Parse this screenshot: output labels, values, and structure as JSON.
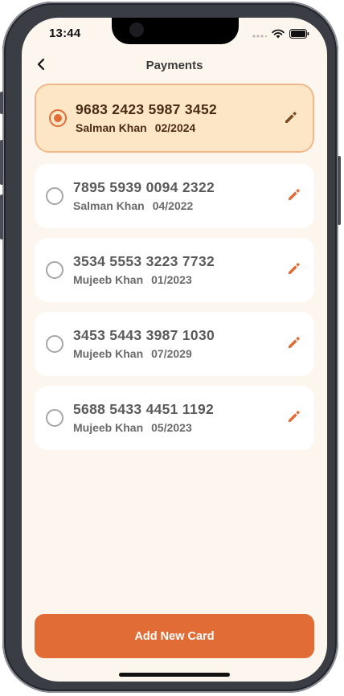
{
  "status_bar": {
    "time": "13:44",
    "icons": [
      "signal-dots-icon",
      "wifi-icon",
      "battery-icon"
    ]
  },
  "header": {
    "back_icon": "chevron-left-icon",
    "title": "Payments"
  },
  "cards": [
    {
      "number": "9683 2423 5987 3452",
      "holder": "Salman Khan",
      "expiry": "02/2024",
      "selected": true
    },
    {
      "number": "7895 5939 0094 2322",
      "holder": "Salman Khan",
      "expiry": "04/2022",
      "selected": false
    },
    {
      "number": "3534 5553 3223 7732",
      "holder": "Mujeeb Khan",
      "expiry": "01/2023",
      "selected": false
    },
    {
      "number": "3453 5443 3987 1030",
      "holder": "Mujeeb Khan",
      "expiry": "07/2029",
      "selected": false
    },
    {
      "number": "5688 5433 4451 1192",
      "holder": "Mujeeb Khan",
      "expiry": "05/2023",
      "selected": false
    }
  ],
  "add_button": {
    "label": "Add New Card"
  },
  "colors": {
    "accent": "#e26c36",
    "background": "#fdf6ee",
    "selected_card": "#fde6c6",
    "selected_border": "#f2b78a",
    "edit_selected": "#7a4a22"
  }
}
